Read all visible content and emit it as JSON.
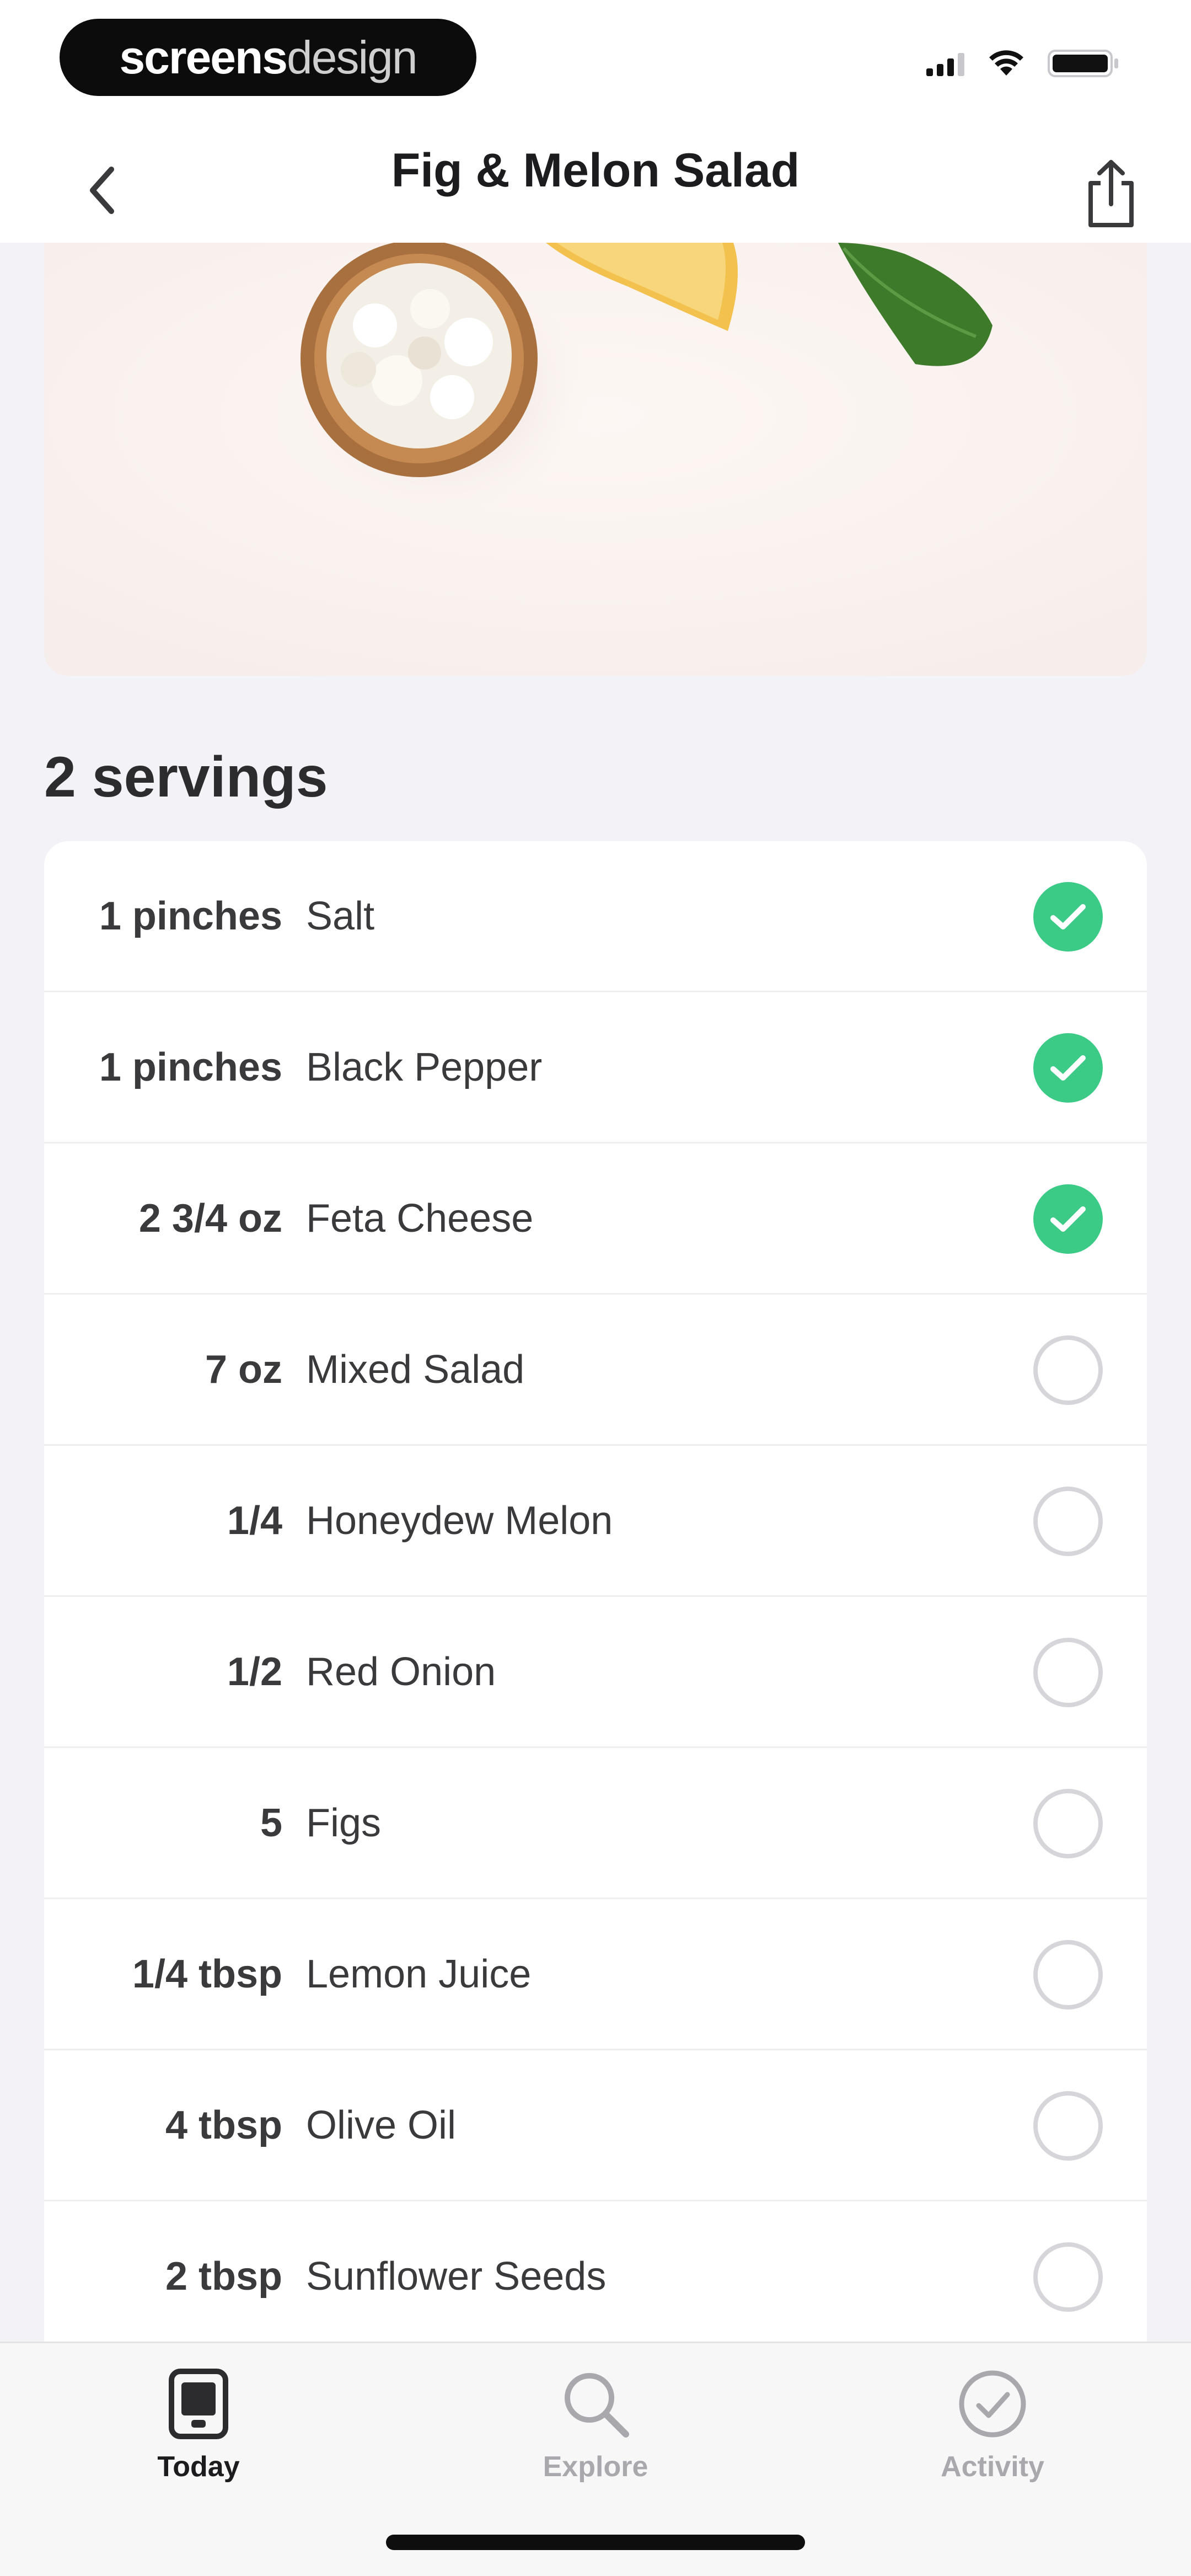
{
  "status_bar": {
    "brand_bold": "screens",
    "brand_light": "design"
  },
  "nav": {
    "title": "Fig & Melon Salad"
  },
  "servings": {
    "label": "2 servings"
  },
  "ingredients": [
    {
      "qty": "1 pinches",
      "name": "Salt",
      "checked": true
    },
    {
      "qty": "1 pinches",
      "name": "Black Pepper",
      "checked": true
    },
    {
      "qty": "2 3/4 oz",
      "name": "Feta Cheese",
      "checked": true
    },
    {
      "qty": "7 oz",
      "name": "Mixed Salad",
      "checked": false
    },
    {
      "qty": "1/4",
      "name": "Honeydew Melon",
      "checked": false
    },
    {
      "qty": "1/2",
      "name": "Red Onion",
      "checked": false
    },
    {
      "qty": "5",
      "name": "Figs",
      "checked": false
    },
    {
      "qty": "1/4 tbsp",
      "name": "Lemon Juice",
      "checked": false
    },
    {
      "qty": "4 tbsp",
      "name": "Olive Oil",
      "checked": false
    },
    {
      "qty": "2 tbsp",
      "name": "Sunflower Seeds",
      "checked": false
    }
  ],
  "tabs": [
    {
      "label": "Today",
      "icon": "today-icon",
      "active": true
    },
    {
      "label": "Explore",
      "icon": "search-icon",
      "active": false
    },
    {
      "label": "Activity",
      "icon": "check-circle-icon",
      "active": false
    }
  ],
  "colors": {
    "accent_green": "#3CCB86",
    "background": "#F2F2F7"
  }
}
